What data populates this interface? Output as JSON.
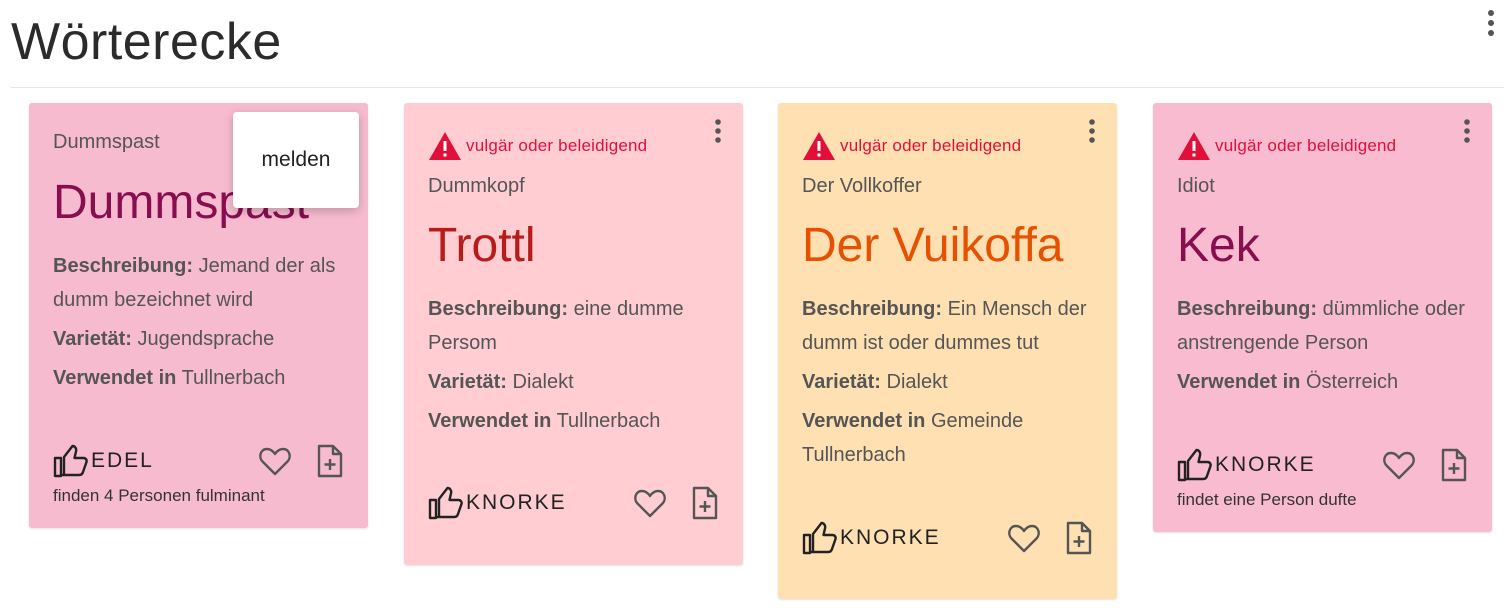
{
  "page": {
    "title": "Wörterecke",
    "menu_icon": "more-vert-icon"
  },
  "popup": {
    "item_label": "melden"
  },
  "cards": [
    {
      "color": "#f7bbd0",
      "word_color": "#880e4f",
      "warning": "",
      "standard": "Dummspast",
      "word": "Dummspast",
      "description_label": "Beschreibung:",
      "description": "Jemand der als dumm bezeichnet wird",
      "variety_label": "Varietät:",
      "variety": "Jugendsprache",
      "used_in_label": "Verwendet in",
      "used_in": "Tullnerbach",
      "rating_label": "EDEL",
      "rating_text": "finden 4 Personen fulminant"
    },
    {
      "color": "#ffcdd2",
      "word_color": "#b71c1c",
      "warning": "vulgär oder beleidigend",
      "standard": "Dummkopf",
      "word": "Trottl",
      "description_label": "Beschreibung:",
      "description": "eine dumme Persom",
      "variety_label": "Varietät:",
      "variety": "Dialekt",
      "used_in_label": "Verwendet in",
      "used_in": "Tullnerbach",
      "rating_label": "KNORKE",
      "rating_text": ""
    },
    {
      "color": "#ffe0b2",
      "word_color": "#e65100",
      "warning": "vulgär oder beleidigend",
      "standard": "Der Vollkoffer",
      "word": "Der Vuikoffa",
      "description_label": "Beschreibung:",
      "description": "Ein Mensch der dumm ist oder dummes tut",
      "variety_label": "Varietät:",
      "variety": "Dialekt",
      "used_in_label": "Verwendet in",
      "used_in": "Gemeinde Tullnerbach",
      "rating_label": "KNORKE",
      "rating_text": ""
    },
    {
      "color": "#f8bbd0",
      "word_color": "#880e4f",
      "warning": "vulgär oder beleidigend",
      "standard": "Idiot",
      "word": "Kek",
      "description_label": "Beschreibung:",
      "description": "dümmliche oder anstrengende Person",
      "variety_label": "",
      "variety": "",
      "used_in_label": "Verwendet in",
      "used_in": "Österreich",
      "rating_label": "KNORKE",
      "rating_text": "findet eine Person dufte"
    }
  ],
  "icons": {
    "warning": "warning-icon",
    "rating": "thumb-up-icon",
    "favorite": "heart-icon",
    "add_to_list": "add-document-icon",
    "menu": "more-vert-icon"
  },
  "colors": {
    "warning_red": "#e0103a"
  }
}
